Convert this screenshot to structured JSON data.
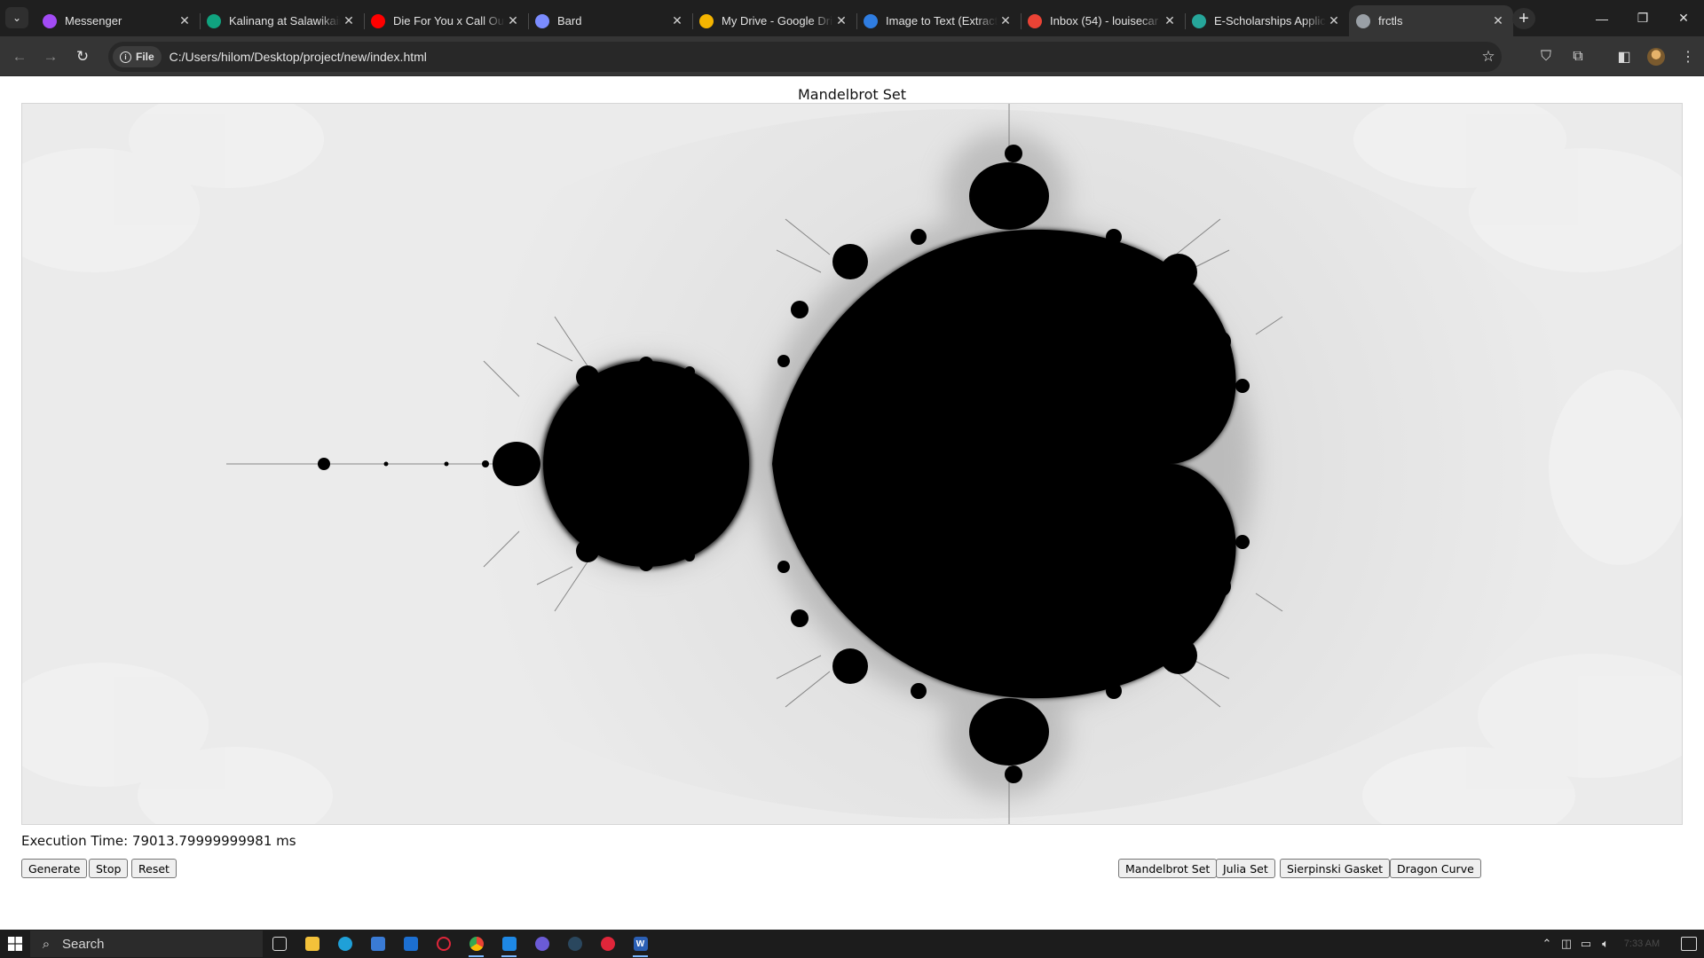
{
  "browser": {
    "tabs": [
      {
        "title": "Messenger",
        "icon": "messenger-icon",
        "color": "#a24bf5"
      },
      {
        "title": "Kalinang at Salawikain",
        "icon": "chatgpt-icon",
        "color": "#10a37f"
      },
      {
        "title": "Die For You x Call Out",
        "icon": "youtube-icon",
        "color": "#ff0000"
      },
      {
        "title": "Bard",
        "icon": "bard-icon",
        "color": "#7b8cff"
      },
      {
        "title": "My Drive - Google Drive",
        "icon": "google-drive-icon",
        "color": "#f4b400"
      },
      {
        "title": "Image to Text (Extract",
        "icon": "image-to-text-icon",
        "color": "#2f7de1"
      },
      {
        "title": "Inbox (54) - louisecar",
        "icon": "gmail-icon",
        "color": "#ea4335"
      },
      {
        "title": "E-Scholarships Applic",
        "icon": "scholarship-icon",
        "color": "#26a69a"
      },
      {
        "title": "frctls",
        "icon": "globe-icon",
        "color": "#9aa0a6",
        "active": true
      }
    ],
    "site_chip": "File",
    "url": "C:/Users/hilom/Desktop/project/new/index.html"
  },
  "page": {
    "title": "Mandelbrot Set",
    "execution_time": "Execution Time: 79013.79999999981 ms",
    "controls": {
      "generate": "Generate",
      "stop": "Stop",
      "reset": "Reset"
    },
    "fractal_buttons": {
      "mandelbrot": "Mandelbrot Set",
      "julia": "Julia Set",
      "sierpinski": "Sierpinski Gasket",
      "dragon": "Dragon Curve"
    }
  },
  "taskbar": {
    "search_label": "Search",
    "clock": "7:33 AM"
  },
  "colors": {
    "fractal_set": "#000000",
    "fractal_background": "#ebebeb",
    "tab_bar": "#1f1f1f",
    "toolbar": "#353535"
  }
}
